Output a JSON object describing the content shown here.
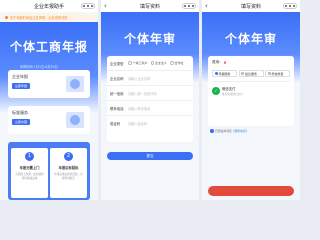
{
  "panel1": {
    "nav_title": "企业年报助手",
    "notice": "关于年报时间及注意事项，点击查看详情",
    "hero_title": "个体工商年报",
    "hero_sub": "年报时间 1月1日-6月30日",
    "cards": [
      {
        "label": "企业年报",
        "button": "立即年报"
      },
      {
        "label": "标准服务",
        "button": "立即办理"
      }
    ],
    "steps": [
      {
        "num": "1",
        "title": "年报无需上门",
        "desc": "全程线上办理，提交资料即可快速完成"
      },
      {
        "num": "2",
        "title": "年报后有回执",
        "desc": "年报完成后提供回执，方便查询核实"
      }
    ]
  },
  "panel2": {
    "nav_title": "填写资料",
    "hero_title": "个体年审",
    "type_label": "企业类型",
    "type_options": [
      "个体工商户",
      "企业法人",
      "合作社"
    ],
    "fields": [
      {
        "label": "企业名称",
        "placeholder": "请输入企业名称"
      },
      {
        "label": "统一信用",
        "placeholder": "请输入统一信用代码"
      },
      {
        "label": "联系电话",
        "placeholder": "请输入联系电话"
      },
      {
        "label": "验证码",
        "placeholder": "请输入验证码"
      }
    ],
    "submit": "提交"
  },
  "panel3": {
    "nav_title": "填写资料",
    "hero_title": "个体年审",
    "fee_label": "费用：",
    "fee_value": "¥",
    "options": [
      {
        "label": "年报服务",
        "selected": true
      },
      {
        "label": "加急服务",
        "selected": false
      },
      {
        "label": "异常修复",
        "selected": false
      }
    ],
    "pay_name": "微信支付",
    "pay_sub": "推荐使用微信支付",
    "agree_text": "已阅读并同意",
    "agree_link": "《服务协议》",
    "colors": {
      "primary": "#3b6ff5",
      "pay_button": "#e24b3b",
      "wechat": "#18b44a"
    }
  }
}
